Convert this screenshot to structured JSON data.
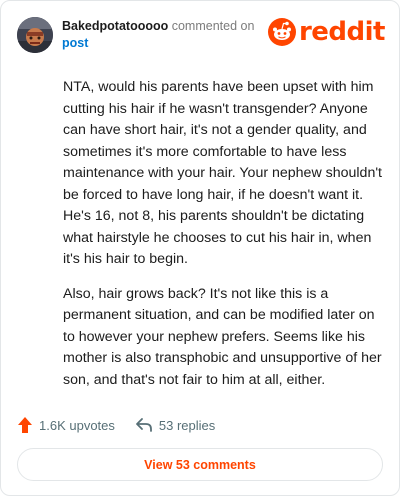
{
  "comment": {
    "username": "Bakedpotatooooo",
    "action_text": "commented on",
    "target": "post",
    "paragraphs": [
      "NTA, would his parents have been upset with him cutting his hair if he wasn't transgender? Anyone can have short hair, it's not a gender quality, and sometimes it's more comfortable to have less maintenance with your hair. Your nephew shouldn't be forced to have long hair, if he doesn't want it. He's 16, not 8, his parents shouldn't be dictating what hairstyle he chooses to cut his hair in, when it's his hair to begin.",
      "Also, hair grows back? It's not like this is a permanent situation, and can be modified later on to however your nephew prefers. Seems like his mother is also transphobic and unsupportive of her son, and that's not fair to him at all, either."
    ],
    "upvotes_label": "1.6K upvotes",
    "replies_label": "53 replies",
    "view_comments_label": "View 53 comments"
  },
  "brand": {
    "wordmark": "reddit",
    "accent_color": "#ff4500",
    "link_color": "#0079d3"
  },
  "icons": {
    "upvote": "upvote-arrow-icon",
    "reply": "reply-arrow-icon",
    "logo": "reddit-snoo-logo"
  }
}
